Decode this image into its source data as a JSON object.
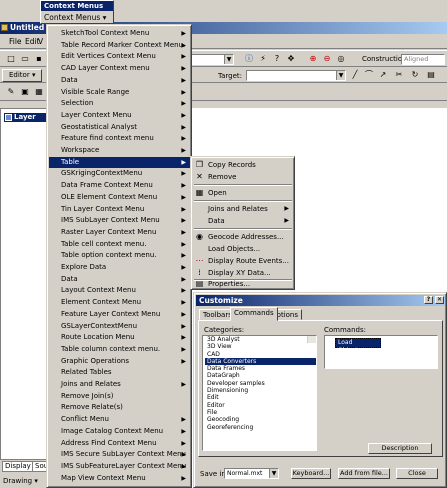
{
  "app": {
    "title": "Untitled",
    "menus": [
      "File",
      "Edit",
      "V"
    ],
    "editor_label": "Editor",
    "construction_label": "Construction",
    "aligned_placeholder": "Aligned",
    "target_label": "Target:",
    "layers_label": "Layer",
    "tabs": [
      "Display",
      "Sou"
    ],
    "drawing_label": "Drawing"
  },
  "context_toolbar": {
    "title": "Context Menus",
    "button": "Context Menus"
  },
  "main_menu": {
    "items": [
      "SketchTool Context Menu",
      "Table Record Marker Context Menu.",
      "Edit Vertices Context Menu",
      "CAD Layer Context menu",
      "Data",
      "Visible Scale Range",
      "Selection",
      "Layer Context Menu",
      "Geostatistical Analyst",
      "Feature find context menu",
      "Workspace",
      "Table",
      "GSKrigingContextMenu",
      "Data Frame Context Menu",
      "OLE Element Context Menu",
      "Tin Layer Context Menu",
      "IMS SubLayer Context Menu",
      "Raster Layer Context Menu",
      "Table cell context menu.",
      "Table option context menu.",
      "Explore Data",
      "Data",
      "Layout Context Menu",
      "Element Context Menu",
      "Feature Layer Context Menu",
      "GSLayerContextMenu",
      "Route Location Menu",
      "Table column context menu.",
      "Graphic Operations",
      "Related Tables",
      "Joins and Relates",
      "Remove Join(s)",
      "Remove Relate(s)",
      "Conflict Menu",
      "Image Catalog Context Menu",
      "Address Find Context Menu",
      "IMS Secure SubLayer Context Menu",
      "IMS SubFeatureLayer Context Menu",
      "Map View Context Menu"
    ]
  },
  "table_submenu": {
    "items": [
      "Copy Records",
      "Remove",
      "Open",
      "Joins and Relates",
      "Data",
      "Geocode Addresses...",
      "Load Objects...",
      "Display Route Events...",
      "Display XY Data...",
      "Properties..."
    ]
  },
  "customize": {
    "title": "Customize",
    "tabs": [
      "Toolbars",
      "Commands",
      "Options"
    ],
    "categories_label": "Categories:",
    "commands_label": "Commands:",
    "categories": [
      "3D Analyst",
      "3D View",
      "CAD",
      "Data Converters",
      "Data Frames",
      "DataGraph",
      "Developer samples",
      "Dimensioning",
      "Edit",
      "Editor",
      "File",
      "Geocoding",
      "Georeferencing"
    ],
    "selected_category": "Data Converters",
    "command_item": "Load Objects...",
    "description_button": "Description",
    "save_in_label": "Save in:",
    "save_in_value": "Normal.mxt",
    "keyboard_button": "Keyboard...",
    "add_from_file_button": "Add from file...",
    "close_button": "Close"
  },
  "colors": {
    "menu_bg": "#d4d0c8",
    "highlight": "#0a246a",
    "window": "#ffffff"
  }
}
